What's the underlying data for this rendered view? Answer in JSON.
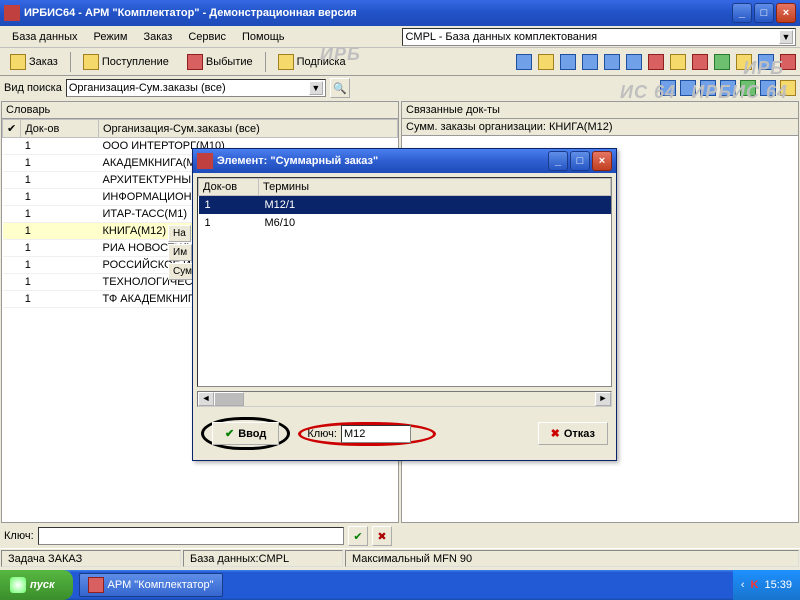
{
  "window": {
    "title": "ИРБИС64 - АРМ \"Комплектатор\" - Демонстрационная версия"
  },
  "menu": {
    "db": "База данных",
    "mode": "Режим",
    "order": "Заказ",
    "service": "Сервис",
    "help": "Помощь"
  },
  "db_combo": "CMPL - База данных комплектования",
  "toolbar": {
    "order": "Заказ",
    "receipt": "Поступление",
    "disposal": "Выбытие",
    "subscribe": "Подписка"
  },
  "search": {
    "label": "Вид поиска",
    "value": "Организация-Сум.заказы (все)"
  },
  "left": {
    "header": "Словарь",
    "col_cnt": "Док-ов",
    "col_term": "Организация-Сум.заказы (все)",
    "rows": [
      {
        "cnt": "1",
        "term": "ООО ИНТЕРТОРГ(М10)"
      },
      {
        "cnt": "1",
        "term": "АКАДЕМКНИГА(М8)"
      },
      {
        "cnt": "1",
        "term": "АРХИТЕКТУРНЫЙ"
      },
      {
        "cnt": "1",
        "term": "ИНФОРМАЦИОННО"
      },
      {
        "cnt": "1",
        "term": "ИТАР-ТАСС(М1)"
      },
      {
        "cnt": "1",
        "term": "КНИГА(М12)",
        "sel": true
      },
      {
        "cnt": "1",
        "term": "РИА НОВОСТИ(М6"
      },
      {
        "cnt": "1",
        "term": "РОССИЙСКОЕ ИН"
      },
      {
        "cnt": "1",
        "term": "ТЕХНОЛОГИЧЕСКИ"
      },
      {
        "cnt": "1",
        "term": "ТФ АКАДЕМКНИГА"
      }
    ]
  },
  "right": {
    "header": "Связанные док-ты",
    "subheader": "Сумм. заказы организации: КНИГА(М12)"
  },
  "sidetabs": {
    "t1": "На",
    "t2": "Им",
    "t3": "Сум"
  },
  "dialog": {
    "title": "Элемент: \"Суммарный заказ\"",
    "col_cnt": "Док-ов",
    "col_term": "Термины",
    "rows": [
      {
        "cnt": "1",
        "term": "М12/1",
        "sel": true
      },
      {
        "cnt": "1",
        "term": "М6/10"
      }
    ],
    "ok": "Ввод",
    "cancel": "Отказ",
    "key_label": "Ключ:",
    "key_value": "М12"
  },
  "key": {
    "label": "Ключ:",
    "value": ""
  },
  "status": {
    "s1": "Задача ЗАКАЗ",
    "s2": "База данных:CMPL",
    "s3": "Максимальный MFN 90"
  },
  "taskbar": {
    "start": "пуск",
    "app": "АРМ \"Комплектатор\"",
    "time": "15:39"
  }
}
